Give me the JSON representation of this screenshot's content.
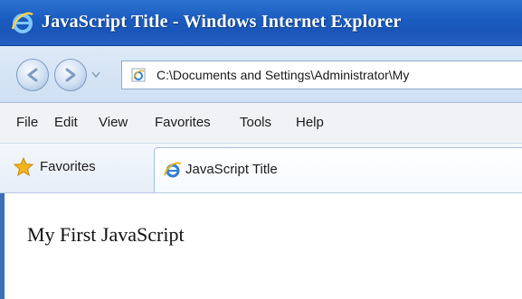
{
  "window": {
    "title": "JavaScript Title - Windows Internet Explorer"
  },
  "address_bar": {
    "url": "C:\\Documents and Settings\\Administrator\\My"
  },
  "menu": {
    "items": [
      "File",
      "Edit",
      "View",
      "Favorites",
      "Tools",
      "Help"
    ]
  },
  "favorites_bar": {
    "favorites_label": "Favorites",
    "tab_label": "JavaScript Title"
  },
  "content": {
    "text": "My First JavaScript"
  },
  "icons": {
    "browser_logo": "internet-explorer-logo",
    "back": "back-arrow-icon",
    "forward": "forward-arrow-icon",
    "favorites": "star-icon",
    "page": "ie-page-icon"
  },
  "colors": {
    "titlebar": "#1b5bc0",
    "address_row": "#cfe0f3",
    "menubar": "#f0f2f5",
    "content_bg": "#ffffff"
  }
}
